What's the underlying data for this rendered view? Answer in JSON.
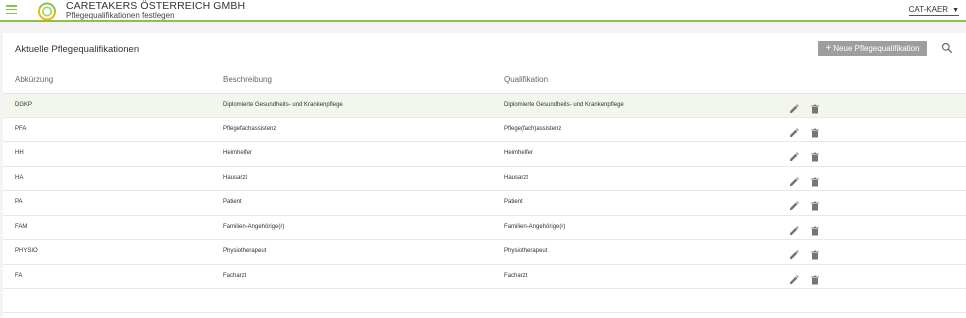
{
  "header": {
    "company": "CARETAKERS ÖSTERREICH GMBH",
    "subtitle": "Pflegequalifikationen festlegen",
    "user": "CAT-KAER",
    "accent_color": "#8bc34a",
    "icons": {
      "menu": "menu-icon",
      "logo": "logo-icon",
      "user_caret": "caret-down-icon"
    }
  },
  "main": {
    "title": "Aktuelle Pflegequalifikationen",
    "new_button_label": "Neue Pflegequalifikation",
    "columns": [
      "Abkürzung",
      "Beschreibung",
      "Qualifikation"
    ],
    "rows": [
      {
        "abbr": "DGKP",
        "description": "Diplomierte Gesundheits- und Krankenpflege",
        "qualification": "Diplomierte Gesundheits- und Krankenpflege",
        "selected": true
      },
      {
        "abbr": "PFA",
        "description": "Pflegefachassistenz",
        "qualification": "Pflege(fach)assistenz",
        "selected": false
      },
      {
        "abbr": "HH",
        "description": "Heimhelfer",
        "qualification": "Heimhelfer",
        "selected": false
      },
      {
        "abbr": "HA",
        "description": "Hausarzt",
        "qualification": "Hausarzt",
        "selected": false
      },
      {
        "abbr": "PA",
        "description": "Patient",
        "qualification": "Patient",
        "selected": false
      },
      {
        "abbr": "FAM",
        "description": "Familien-Angehörige(r)",
        "qualification": "Familien-Angehörige(r)",
        "selected": false
      },
      {
        "abbr": "PHYSIO",
        "description": "Physiotherapeut",
        "qualification": "Physiotherapeut",
        "selected": false
      },
      {
        "abbr": "FA",
        "description": "Facharzt",
        "qualification": "Facharzt",
        "selected": false
      }
    ],
    "icons": {
      "search": "search-icon",
      "edit": "pencil-icon",
      "delete": "trash-icon",
      "add": "plus-icon"
    }
  }
}
